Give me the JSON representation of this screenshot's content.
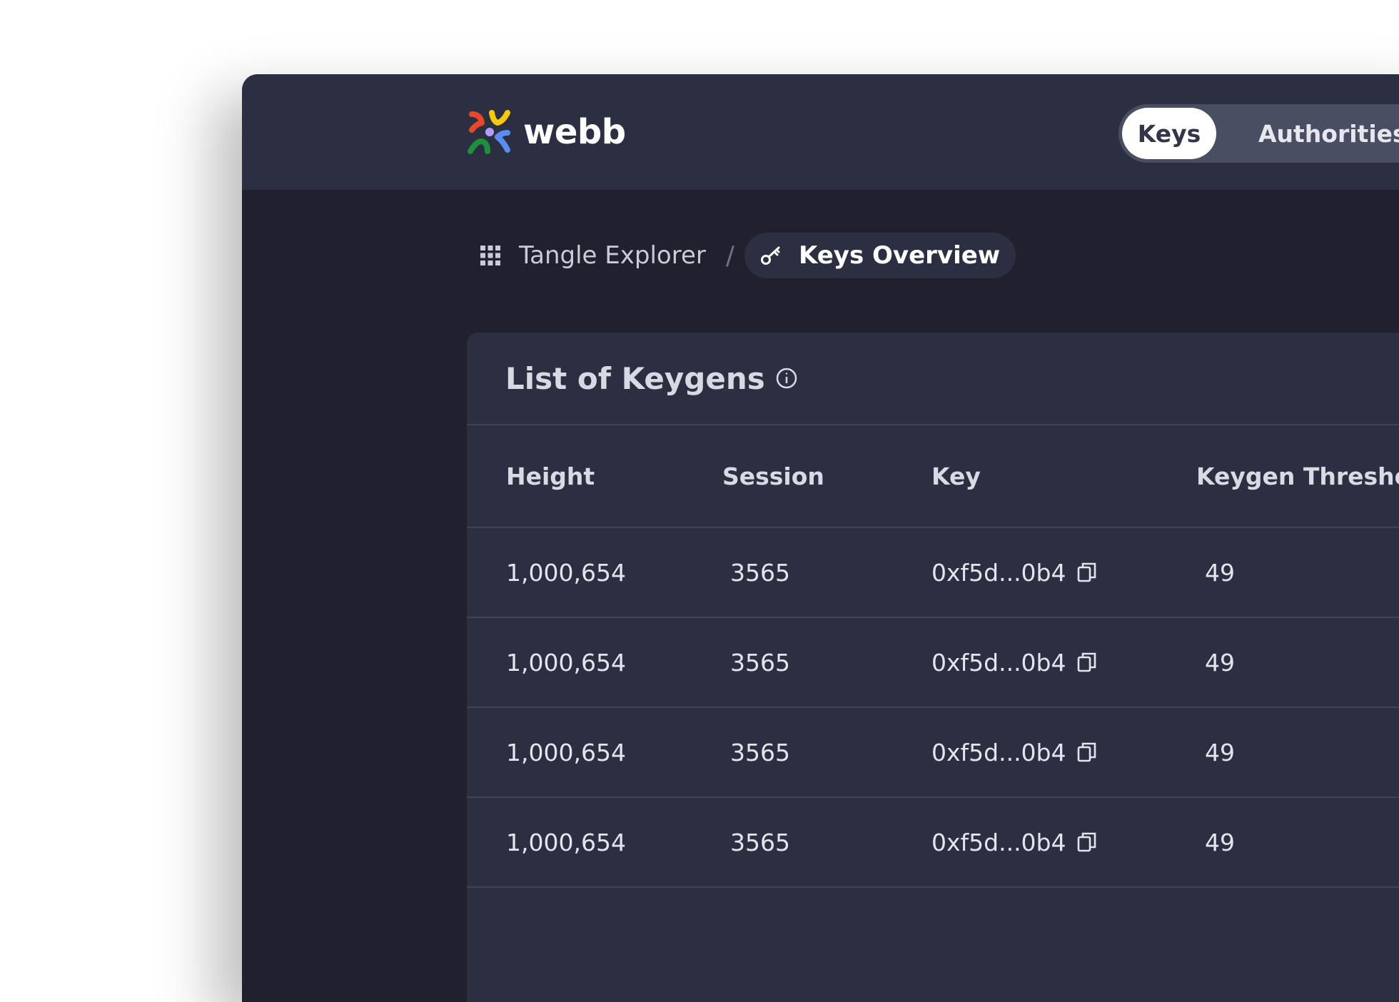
{
  "brand": {
    "name": "webb"
  },
  "nav": {
    "tabs": [
      {
        "label": "Keys",
        "active": true
      },
      {
        "label": "Authorities",
        "active": false
      }
    ]
  },
  "breadcrumb": {
    "root": "Tangle Explorer",
    "separator": "/",
    "current": "Keys Overview"
  },
  "card": {
    "title": "List of Keygens",
    "columns": [
      "Height",
      "Session",
      "Key",
      "Keygen Threshold"
    ],
    "rows": [
      {
        "height": "1,000,654",
        "session": "3565",
        "key": "0xf5d...0b4",
        "threshold": "49"
      },
      {
        "height": "1,000,654",
        "session": "3565",
        "key": "0xf5d...0b4",
        "threshold": "49"
      },
      {
        "height": "1,000,654",
        "session": "3565",
        "key": "0xf5d...0b4",
        "threshold": "49"
      },
      {
        "height": "1,000,654",
        "session": "3565",
        "key": "0xf5d...0b4",
        "threshold": "49"
      }
    ]
  },
  "colors": {
    "topbar": "#2c2f42",
    "background": "#21202e",
    "card": "#2c2f42",
    "active_tab": "#ffffff"
  },
  "icons": {
    "logo": "webb-logo-icon",
    "breadcrumb_root": "grid-icon",
    "breadcrumb_current": "key-icon",
    "title_info": "info-icon",
    "copy": "copy-icon"
  }
}
